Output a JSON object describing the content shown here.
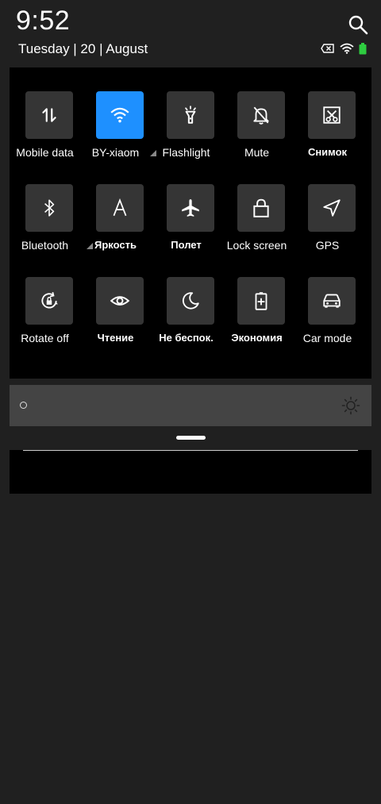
{
  "status": {
    "time": "9:52",
    "date": "Tuesday | 20 | August",
    "icons": [
      "sim-off-icon",
      "wifi-icon",
      "battery-icon"
    ],
    "battery_color": "#2ecc40"
  },
  "colors": {
    "background": "#202020",
    "panel": "#000000",
    "tile": "#353535",
    "tile_active": "#1e90ff"
  },
  "toggles": [
    {
      "label": "Mobile data",
      "icon": "mobile-data-icon",
      "active": false
    },
    {
      "label": "BY-xiaom",
      "icon": "wifi-icon",
      "active": true,
      "expand": true
    },
    {
      "label": "Flashlight",
      "icon": "flashlight-icon",
      "active": false
    },
    {
      "label": "Mute",
      "icon": "mute-icon",
      "active": false
    },
    {
      "label": "Снимок",
      "icon": "screenshot-icon",
      "active": false
    },
    {
      "label": "Bluetooth",
      "icon": "bluetooth-icon",
      "active": false,
      "expand": true
    },
    {
      "label": "Яркость",
      "icon": "auto-brightness-icon",
      "active": false
    },
    {
      "label": "Полет",
      "icon": "airplane-icon",
      "active": false
    },
    {
      "label": "Lock screen",
      "icon": "lock-icon",
      "active": false
    },
    {
      "label": "GPS",
      "icon": "gps-icon",
      "active": false
    },
    {
      "label": "Rotate off",
      "icon": "rotate-lock-icon",
      "active": false
    },
    {
      "label": "Чтение",
      "icon": "eye-icon",
      "active": false
    },
    {
      "label": "Не беспок.",
      "icon": "moon-icon",
      "active": false
    },
    {
      "label": "Экономия",
      "icon": "battery-saver-icon",
      "active": false
    },
    {
      "label": "Car mode",
      "icon": "car-icon",
      "active": false
    }
  ],
  "brightness": {
    "level": 0.0,
    "icon": "sun-icon"
  }
}
